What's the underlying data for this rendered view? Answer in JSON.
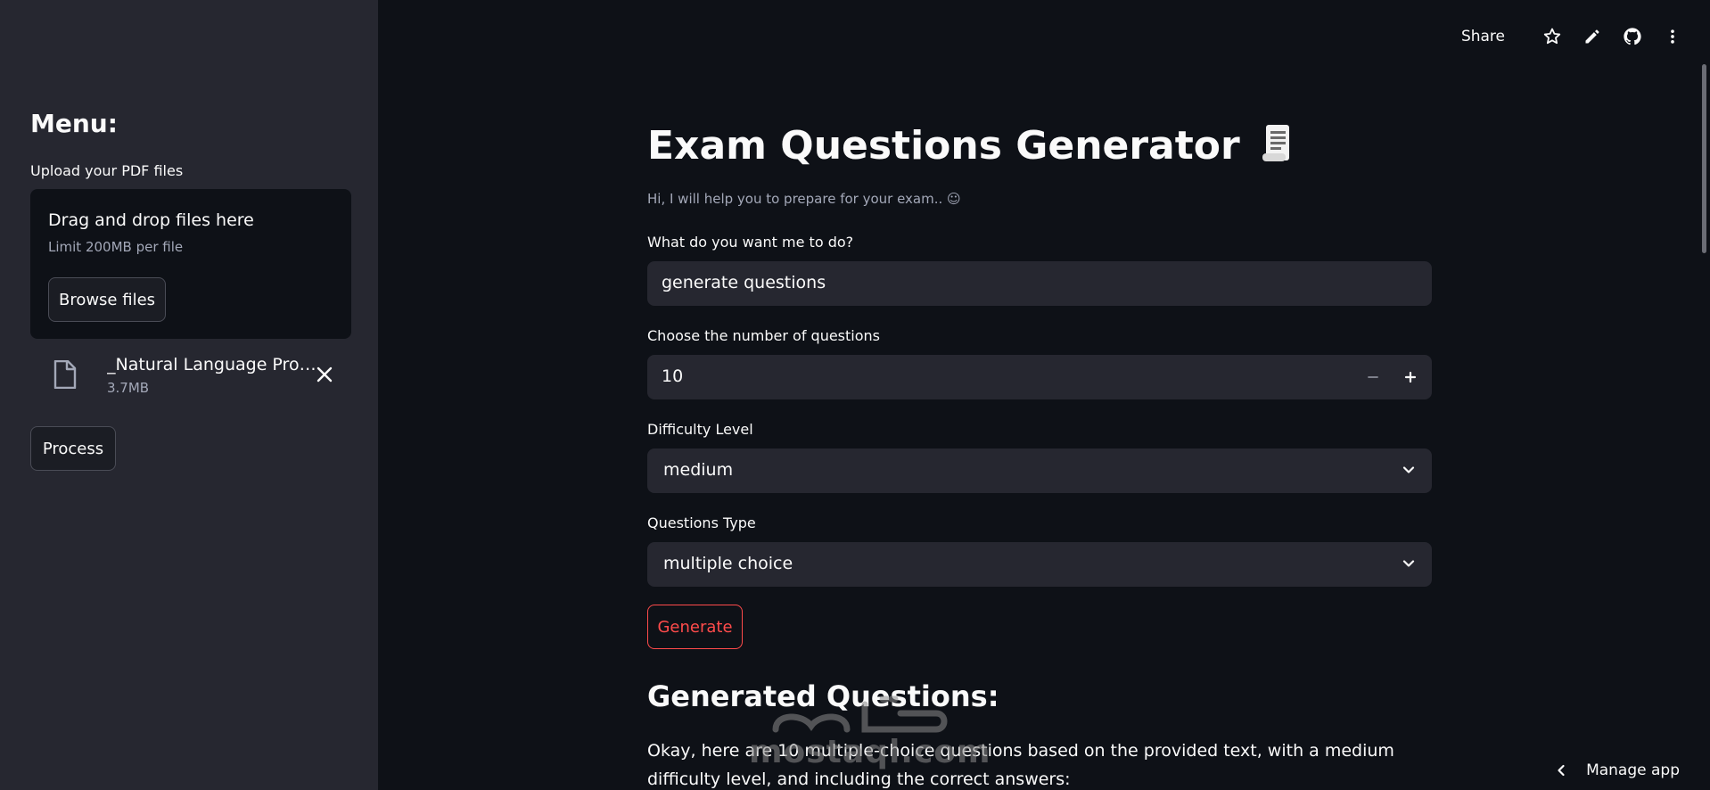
{
  "sidebar": {
    "menu_title": "Menu:",
    "upload_label": "Upload your PDF files",
    "dropzone": {
      "title": "Drag and drop files here",
      "limit": "Limit 200MB per file",
      "browse_label": "Browse files"
    },
    "file": {
      "name": "_Natural Language Processing.pdf",
      "size": "3.7MB",
      "icon": "file-icon"
    },
    "process_label": "Process"
  },
  "header": {
    "share_label": "Share",
    "icons": [
      "star-icon",
      "edit-icon",
      "github-icon",
      "more-vertical-icon"
    ]
  },
  "main": {
    "title": "Exam Questions Generator",
    "title_emoji": "scroll-icon",
    "subtitle": "Hi, I will help you to prepare for your exam.. ☺",
    "task": {
      "label": "What do you want me to do?",
      "value": "generate questions"
    },
    "num_questions": {
      "label": "Choose the number of questions",
      "value": "10"
    },
    "difficulty": {
      "label": "Difficulty Level",
      "value": "medium"
    },
    "question_type": {
      "label": "Questions Type",
      "value": "multiple choice"
    },
    "generate_label": "Generate",
    "results_title": "Generated Questions:",
    "results_intro": "Okay, here are 10 multiple-choice questions based on the provided text, with a medium difficulty level, and including the correct answers:"
  },
  "watermark": {
    "text": "mostaql.com"
  },
  "footer": {
    "manage_label": "Manage app"
  },
  "colors": {
    "background": "#0e1117",
    "sidebar": "#262730",
    "input": "#262730",
    "accent": "#ff4b4b",
    "text": "#fafafa",
    "muted": "#a3a8b8"
  }
}
